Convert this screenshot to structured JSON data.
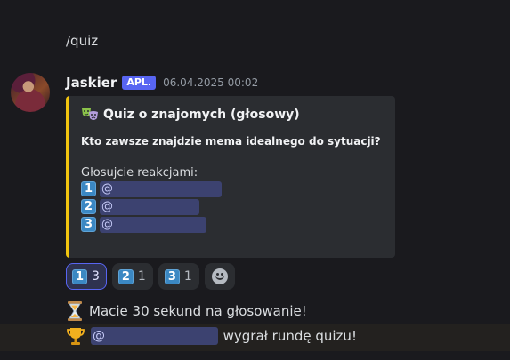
{
  "previous_message": {
    "text": "/quiz"
  },
  "author": {
    "name": "Jaskier",
    "badge": "APL.",
    "timestamp": "06.04.2025 00:02"
  },
  "embed": {
    "accent_color": "#f1c40f",
    "title": "Quiz o znajomych (głosowy)",
    "title_icon": "performing-arts-emoji",
    "question": "Kto zawsze znajdzie mema idealnego do sytuacji?",
    "instructions": "Głosujcie reakcjami:",
    "options": [
      {
        "number": "1",
        "mention": "@                             "
      },
      {
        "number": "2",
        "mention": "@                       "
      },
      {
        "number": "3",
        "mention": "@                         "
      }
    ]
  },
  "reactions": [
    {
      "emoji": "1",
      "count": "3",
      "active": true
    },
    {
      "emoji": "2",
      "count": "1",
      "active": false
    },
    {
      "emoji": "3",
      "count": "1",
      "active": false
    }
  ],
  "add_reaction_icon": "smiley-add-reaction-icon",
  "timer_message": {
    "icon": "hourglass-icon",
    "text": "Macie 30 sekund na głosowanie!"
  },
  "winner_message": {
    "icon": "trophy-icon",
    "mention": "@                            ",
    "text": "wygrał rundę quizu!"
  },
  "colors": {
    "background": "#1a1a1e",
    "blurple": "#5865f2",
    "embed_bg": "#2b2d31",
    "keycap": "#3b88c3"
  }
}
